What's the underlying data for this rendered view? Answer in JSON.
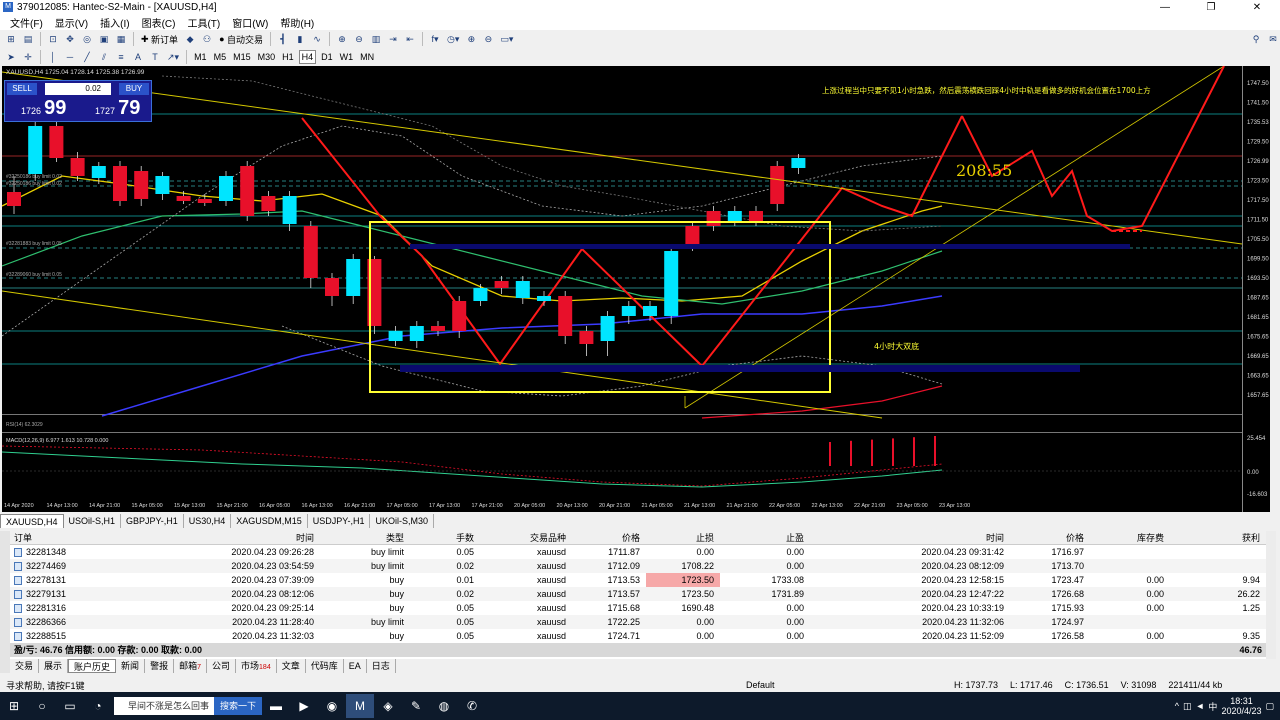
{
  "window": {
    "title": "379012085: Hantec-S2-Main - [XAUUSD,H4]"
  },
  "menu": [
    "文件(F)",
    "显示(V)",
    "插入(I)",
    "图表(C)",
    "工具(T)",
    "窗口(W)",
    "帮助(H)"
  ],
  "toolbar": {
    "new_order": "新订单",
    "auto_trade": "自动交易",
    "timeframes": [
      "M1",
      "M5",
      "M15",
      "M30",
      "H1",
      "H4",
      "D1",
      "W1",
      "MN"
    ]
  },
  "chart": {
    "header": "XAUUSD,H4  1725.04 1728.14 1725.38 1726.99",
    "annotation_top": "上涨过程当中只要不见1小时急跌，然后震荡横跌回踩4小时中轨是看做多的好机会位置在1700上方",
    "annotation_box": "4小时大双底",
    "annotation_time": "208:55",
    "rsi_label": "RSI(14) 62.3029",
    "macd_label": "MACD(12,26,9) 6.977 1.613 10.728 0.000",
    "order_labels": [
      "#32250186 buy limit 0.02",
      "#32250186 buy limit 0.02",
      "#32281883 buy limit 0.05",
      "#32289060 buy limit 0.05"
    ],
    "price_ticks": [
      "1747.50",
      "1741.50",
      "1735.53",
      "1729.50",
      "1726.99",
      "1723.50",
      "1717.50",
      "1711.50",
      "1705.50",
      "1699.50",
      "1693.50",
      "1687.65",
      "1681.65",
      "1675.65",
      "1669.65",
      "1663.65",
      "1657.65"
    ],
    "macd_ticks": [
      "25.454",
      "0.00",
      "-16.603"
    ],
    "time_ticks": [
      "14 Apr 2020",
      "14 Apr 13:00",
      "14 Apr 21:00",
      "15 Apr 05:00",
      "15 Apr 13:00",
      "15 Apr 21:00",
      "16 Apr 05:00",
      "16 Apr 13:00",
      "16 Apr 21:00",
      "17 Apr 05:00",
      "17 Apr 13:00",
      "17 Apr 21:00",
      "20 Apr 05:00",
      "20 Apr 13:00",
      "20 Apr 21:00",
      "21 Apr 05:00",
      "21 Apr 13:00",
      "21 Apr 21:00",
      "22 Apr 05:00",
      "22 Apr 13:00",
      "22 Apr 21:00",
      "23 Apr 05:00",
      "23 Apr 13:00"
    ]
  },
  "trade_widget": {
    "sell": "SELL",
    "buy": "BUY",
    "lot": "0.02",
    "bid_small": "1726",
    "bid_big": "99",
    "ask_small": "1727",
    "ask_big": "79"
  },
  "chart_tabs": [
    "XAUUSD,H4",
    "USOil-S,H1",
    "GBPJPY-,H1",
    "US30,H4",
    "XAGUSDM,M15",
    "USDJPY-,H1",
    "UKOil-S,M30"
  ],
  "terminal": {
    "columns": [
      "订单",
      "时间",
      "类型",
      "手数",
      "交易品种",
      "价格",
      "止损",
      "止盈",
      "时间",
      "价格",
      "库存费",
      "获利"
    ],
    "rows": [
      [
        "32281348",
        "2020.04.23 09:26:28",
        "buy limit",
        "0.05",
        "xauusd",
        "1711.87",
        "0.00",
        "0.00",
        "2020.04.23 09:31:42",
        "1716.97",
        "",
        ""
      ],
      [
        "32274469",
        "2020.04.23 03:54:59",
        "buy limit",
        "0.02",
        "xauusd",
        "1712.09",
        "1708.22",
        "0.00",
        "2020.04.23 08:12:09",
        "1713.70",
        "",
        ""
      ],
      [
        "32278131",
        "2020.04.23 07:39:09",
        "buy",
        "0.01",
        "xauusd",
        "1713.53",
        "1723.50",
        "1733.08",
        "2020.04.23 12:58:15",
        "1723.47",
        "0.00",
        "9.94"
      ],
      [
        "32279131",
        "2020.04.23 08:12:06",
        "buy",
        "0.02",
        "xauusd",
        "1713.57",
        "1723.50",
        "1731.89",
        "2020.04.23 12:47:22",
        "1726.68",
        "0.00",
        "26.22"
      ],
      [
        "32281316",
        "2020.04.23 09:25:14",
        "buy",
        "0.05",
        "xauusd",
        "1715.68",
        "1690.48",
        "0.00",
        "2020.04.23 10:33:19",
        "1715.93",
        "0.00",
        "1.25"
      ],
      [
        "32286366",
        "2020.04.23 11:28:40",
        "buy limit",
        "0.05",
        "xauusd",
        "1722.25",
        "0.00",
        "0.00",
        "2020.04.23 11:32:06",
        "1724.97",
        "",
        ""
      ],
      [
        "32288515",
        "2020.04.23 11:32:03",
        "buy",
        "0.05",
        "xauusd",
        "1724.71",
        "0.00",
        "0.00",
        "2020.04.23 11:52:09",
        "1726.58",
        "0.00",
        "9.35"
      ]
    ],
    "summary_left": "盈/亏: 46.76  信用额: 0.00  存款: 0.00  取款: 0.00",
    "summary_right": "46.76"
  },
  "terminal_tabs": [
    {
      "label": "交易",
      "badge": ""
    },
    {
      "label": "展示",
      "badge": ""
    },
    {
      "label": "账户历史",
      "badge": ""
    },
    {
      "label": "新闻",
      "badge": ""
    },
    {
      "label": "警报",
      "badge": ""
    },
    {
      "label": "邮箱",
      "badge": "7"
    },
    {
      "label": "公司",
      "badge": ""
    },
    {
      "label": "市场",
      "badge": "184"
    },
    {
      "label": "文章",
      "badge": ""
    },
    {
      "label": "代码库",
      "badge": ""
    },
    {
      "label": "EA",
      "badge": ""
    },
    {
      "label": "日志",
      "badge": ""
    }
  ],
  "statusbar": {
    "help": "寻求帮助, 请按F1键",
    "profile": "Default",
    "high": "H: 1737.73",
    "low": "L: 1717.46",
    "close": "C: 1736.51",
    "volume": "V: 31098",
    "traffic": "221411/44 kb"
  },
  "taskbar": {
    "search_text": "早间不涨是怎么回事",
    "search_button": "搜索一下",
    "time": "18:31",
    "date": "2020/4/23",
    "lang": "中"
  },
  "colors": {
    "bull": "#00e5ff",
    "bear": "#e8102a",
    "ma_yellow": "#e8d000",
    "ma_blue": "#3b3bff",
    "box": "#ffff33",
    "annotation": "#ffff33"
  }
}
